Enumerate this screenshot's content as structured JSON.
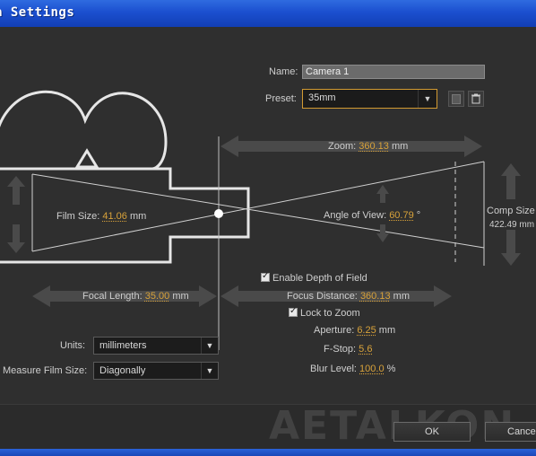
{
  "window": {
    "title": "a Settings"
  },
  "form": {
    "name_label": "Name:",
    "name_value": "Camera 1",
    "preset_label": "Preset:",
    "preset_value": "35mm"
  },
  "diagram": {
    "zoom_label": "Zoom:",
    "zoom_value": "360.13",
    "zoom_unit": "mm",
    "film_size_label": "Film Size:",
    "film_size_value": "41.06",
    "film_size_unit": "mm",
    "angle_label": "Angle of View:",
    "angle_value": "60.79",
    "angle_unit": "°",
    "comp_size_label": "Comp Size",
    "comp_size_value": "422.49 mm",
    "focal_length_label": "Focal Length:",
    "focal_length_value": "35.00",
    "focal_length_unit": "mm",
    "focus_distance_label": "Focus Distance:",
    "focus_distance_value": "360.13",
    "focus_distance_unit": "mm"
  },
  "options": {
    "enable_dof_label": "Enable Depth of Field",
    "enable_dof_checked": true,
    "lock_zoom_label": "Lock to Zoom",
    "lock_zoom_checked": true,
    "aperture_label": "Aperture:",
    "aperture_value": "6.25",
    "aperture_unit": "mm",
    "fstop_label": "F-Stop:",
    "fstop_value": "5.6",
    "blur_label": "Blur Level:",
    "blur_value": "100.0",
    "blur_unit": "%"
  },
  "units": {
    "units_label": "Units:",
    "units_value": "millimeters",
    "measure_label": "Measure Film Size:",
    "measure_value": "Diagonally"
  },
  "buttons": {
    "ok": "OK",
    "cancel": "Cancel"
  },
  "watermark": "AETALKON",
  "colors": {
    "accent": "#d8a23a",
    "title_bar": "#1b4fcf",
    "panel": "#2f2f2f"
  }
}
